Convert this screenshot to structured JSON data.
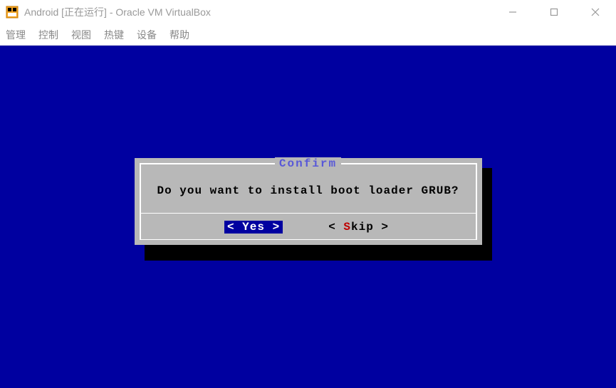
{
  "titlebar": {
    "title": "Android [正在运行] - Oracle VM VirtualBox"
  },
  "menubar": {
    "items": [
      "管理",
      "控制",
      "视图",
      "热键",
      "设备",
      "帮助"
    ]
  },
  "dialog": {
    "title": "Confirm",
    "message": "Do you want to install boot loader GRUB?",
    "yes_open": "<",
    "yes_label": " Yes  ",
    "yes_close": ">",
    "skip_open": "< ",
    "skip_highlight": "S",
    "skip_rest": "kip ",
    "skip_close": ">"
  }
}
